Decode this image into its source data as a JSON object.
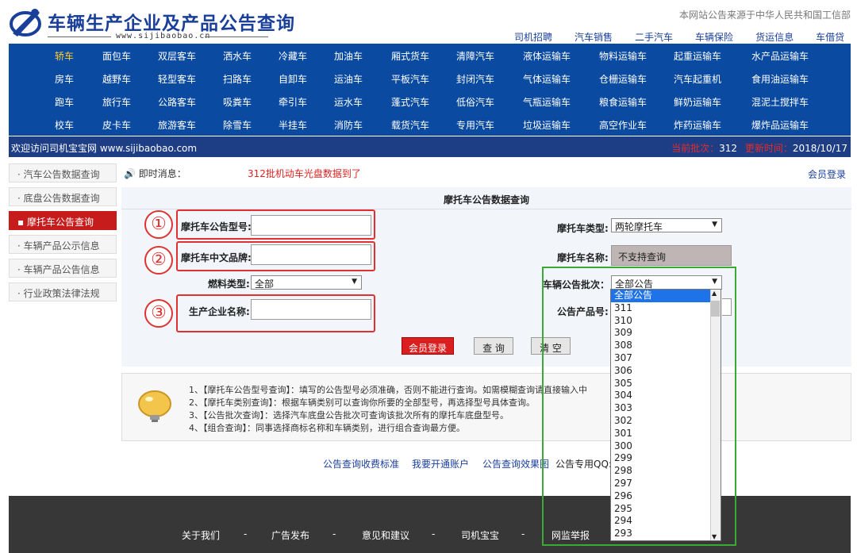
{
  "header": {
    "title": "车辆生产企业及产品公告查询",
    "url": "www.sijibaobao.cn",
    "source_note": "本网站公告来源于中华人民共和国工信部",
    "top_links": [
      "司机招聘",
      "汽车销售",
      "二手汽车",
      "车辆保险",
      "货运信息",
      "车借贷"
    ]
  },
  "nav": {
    "rows": [
      [
        "轿车",
        "面包车",
        "双层客车",
        "洒水车",
        "冷藏车",
        "加油车",
        "厢式货车",
        "清障汽车",
        "液体运输车",
        "物料运输车",
        "起重运输车",
        "水产品运输车"
      ],
      [
        "房车",
        "越野车",
        "轻型客车",
        "扫路车",
        "自卸车",
        "运油车",
        "平板汽车",
        "封闭汽车",
        "气体运输车",
        "仓栅运输车",
        "汽车起重机",
        "食用油运输车"
      ],
      [
        "跑车",
        "旅行车",
        "公路客车",
        "吸粪车",
        "牵引车",
        "运水车",
        "蓬式汽车",
        "低俗汽车",
        "气瓶运输车",
        "粮食运输车",
        "鲜奶运输车",
        "混泥土搅拌车"
      ],
      [
        "校车",
        "皮卡车",
        "旅游客车",
        "除雪车",
        "半挂车",
        "消防车",
        "载货汽车",
        "专用汽车",
        "垃圾运输车",
        "高空作业车",
        "炸药运输车",
        "爆炸品运输车"
      ]
    ]
  },
  "welcome": {
    "text": "欢迎访问司机宝宝网 www.sijibaobao.com",
    "batch_label": "当前批次：",
    "batch_value": "312",
    "update_label": "更新时间：",
    "update_value": "2018/10/17"
  },
  "sidebar": {
    "items": [
      "汽车公告数据查询",
      "底盘公告数据查询",
      "摩托车公告查询",
      "车辆产品公示信息",
      "车辆产品公告信息",
      "行业政策法律法规"
    ]
  },
  "news": {
    "label": "即时消息：",
    "message": "312批机动车光盘数据到了",
    "member_login": "会员登录"
  },
  "form": {
    "title": "摩托车公告数据查询",
    "model_label": "摩托车公告型号:",
    "brand_label": "摩托车中文品牌:",
    "fuel_label": "燃料类型:",
    "fuel_value": "全部",
    "maker_label": "生产企业名称:",
    "type_label": "摩托车类型:",
    "type_value": "两轮摩托车",
    "name_label": "摩托车名称:",
    "name_value": "不支持查询",
    "batch_label": "车辆公告批次：",
    "batch_value": "全部公告",
    "product_label": "公告产品号:",
    "circle1": "①",
    "circle2": "②",
    "circle3": "③",
    "btn_login": "会员登录",
    "btn_query": "查 询",
    "btn_clear": "清 空"
  },
  "dropdown": {
    "options": [
      "全部公告",
      "311",
      "310",
      "309",
      "308",
      "307",
      "306",
      "305",
      "304",
      "303",
      "302",
      "301",
      "300",
      "299",
      "298",
      "297",
      "296",
      "295",
      "294",
      "293"
    ]
  },
  "notes": [
    "1、【摩托车公告型号查询】：填写的公告型号必须准确，否则不能进行查询。如需模糊查询请直接输入中",
    "2、【摩托车类别查询】：根据车辆类别可以查询你所要的全部型号，再选择型号具体查询。",
    "3、【公告批次查询】：选择汽车底盘公告批次可查询该批次所有的摩托车底盘型号。",
    "4、【组合查询】：同事选择商标名称和车辆类别，进行组合查询最方便。"
  ],
  "links": [
    "公告查询收费标准",
    "我要开通账户",
    "公告查询效果图",
    "公告专用QQ:"
  ],
  "footer": [
    "关于我们",
    "-",
    "广告发布",
    "-",
    "意见和建议",
    "-",
    "司机宝宝",
    "-",
    "网监举报"
  ]
}
